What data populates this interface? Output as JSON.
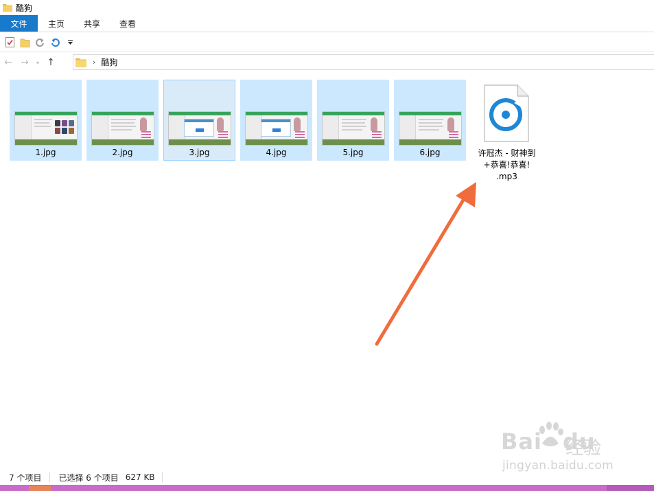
{
  "window": {
    "title": "酷狗"
  },
  "ribbon": {
    "tabs": [
      "文件",
      "主页",
      "共享",
      "查看"
    ]
  },
  "quick_access": {
    "icons": [
      "properties-icon",
      "new-folder-icon",
      "redo-icon",
      "undo-icon",
      "customize-dropdown-icon"
    ]
  },
  "address_bar": {
    "breadcrumb": "酷狗"
  },
  "files": [
    {
      "name": "1.jpg",
      "selected": true
    },
    {
      "name": "2.jpg",
      "selected": true
    },
    {
      "name": "3.jpg",
      "selected": true,
      "focused": true
    },
    {
      "name": "4.jpg",
      "selected": true
    },
    {
      "name": "5.jpg",
      "selected": true
    },
    {
      "name": "6.jpg",
      "selected": true
    },
    {
      "name_lines": [
        "许冠杰 - 财神到",
        "+恭喜!恭喜!",
        ".mp3"
      ],
      "selected": false,
      "icon": "groove-music-icon"
    }
  ],
  "status": {
    "item_count": "7 个项目",
    "selected": "已选择 6 个项目",
    "size": "627 KB"
  },
  "watermark": {
    "logo_a": "Bai",
    "logo_b": "du",
    "jingyan": "经验",
    "url": "jingyan.baidu.com"
  },
  "colors": {
    "accent": "#1979ca",
    "selection": "#cce8ff",
    "arrow": "#f06c3c",
    "taskbar": "#c96bc9"
  }
}
